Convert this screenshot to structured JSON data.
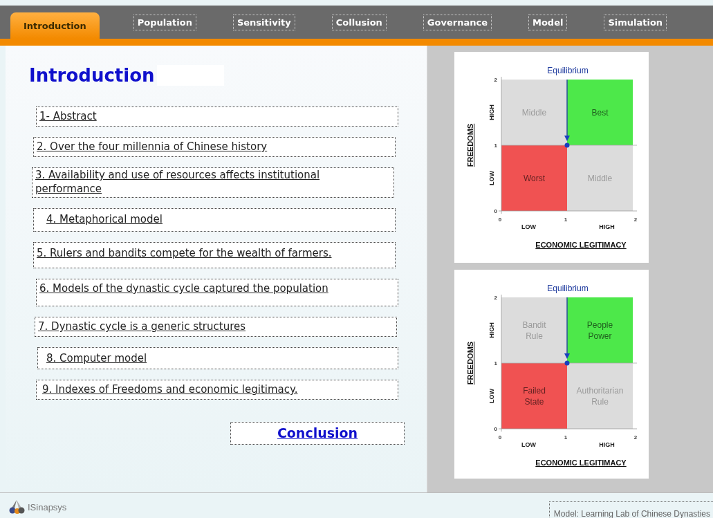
{
  "tabs": [
    {
      "label": "Introduction",
      "selected": true
    },
    {
      "label": "Population",
      "selected": false
    },
    {
      "label": "Sensitivity",
      "selected": false
    },
    {
      "label": "Collusion",
      "selected": false
    },
    {
      "label": "Governance",
      "selected": false
    },
    {
      "label": "Model",
      "selected": false
    },
    {
      "label": "Simulation",
      "selected": false
    }
  ],
  "heading": "Introduction",
  "topics": [
    {
      "label": "1- Abstract"
    },
    {
      "label": "2. Over the four millennia of Chinese history"
    },
    {
      "label": "3. Availability and use of resources affects institutional performance"
    },
    {
      "label": "4. Metaphorical model"
    },
    {
      "label": "5. Rulers and bandits compete for the wealth of farmers."
    },
    {
      "label": "6. Models of the dynastic cycle captured the population"
    },
    {
      "label": "7. Dynastic cycle is a generic structures"
    },
    {
      "label": "8. Computer model"
    },
    {
      "label": "9. Indexes of Freedoms and economic legitimacy."
    }
  ],
  "conclusion": "Conclusion",
  "diagrams": [
    {
      "top_label": "Equilibrium",
      "y_title": "FREEDOMS",
      "x_title": "ECONOMIC LEGITIMACY",
      "x_bands": [
        "LOW",
        "HIGH"
      ],
      "y_bands": [
        "LOW",
        "HIGH"
      ],
      "x_ticks": [
        "0",
        "1",
        "2"
      ],
      "y_ticks": [
        "2",
        "1",
        "0"
      ],
      "quadrants": [
        {
          "label": "Middle",
          "color": "#dcdcdc"
        },
        {
          "label": "Best",
          "color": "#4de84a"
        },
        {
          "label": "Worst",
          "color": "#f05252"
        },
        {
          "label": "Middle",
          "color": "#dcdcdc"
        }
      ]
    },
    {
      "top_label": "Equilibrium",
      "y_title": "FREEDOMS",
      "x_title": "ECONOMIC LEGITIMACY",
      "x_bands": [
        "LOW",
        "HIGH"
      ],
      "y_bands": [
        "LOW",
        "HIGH"
      ],
      "x_ticks": [
        "0",
        "1",
        "2"
      ],
      "y_ticks": [
        "2",
        "1",
        "0"
      ],
      "quadrants": [
        {
          "label": "Bandit Rule",
          "color": "#dcdcdc"
        },
        {
          "label": "People Power",
          "color": "#4de84a"
        },
        {
          "label": "Failed State",
          "color": "#f05252"
        },
        {
          "label": "Authoritarian Rule",
          "color": "#dcdcdc"
        }
      ]
    }
  ],
  "footer": {
    "logo_text": "ISinapsys",
    "model_label": "Model: Learning Lab of Chinese Dynasties"
  }
}
